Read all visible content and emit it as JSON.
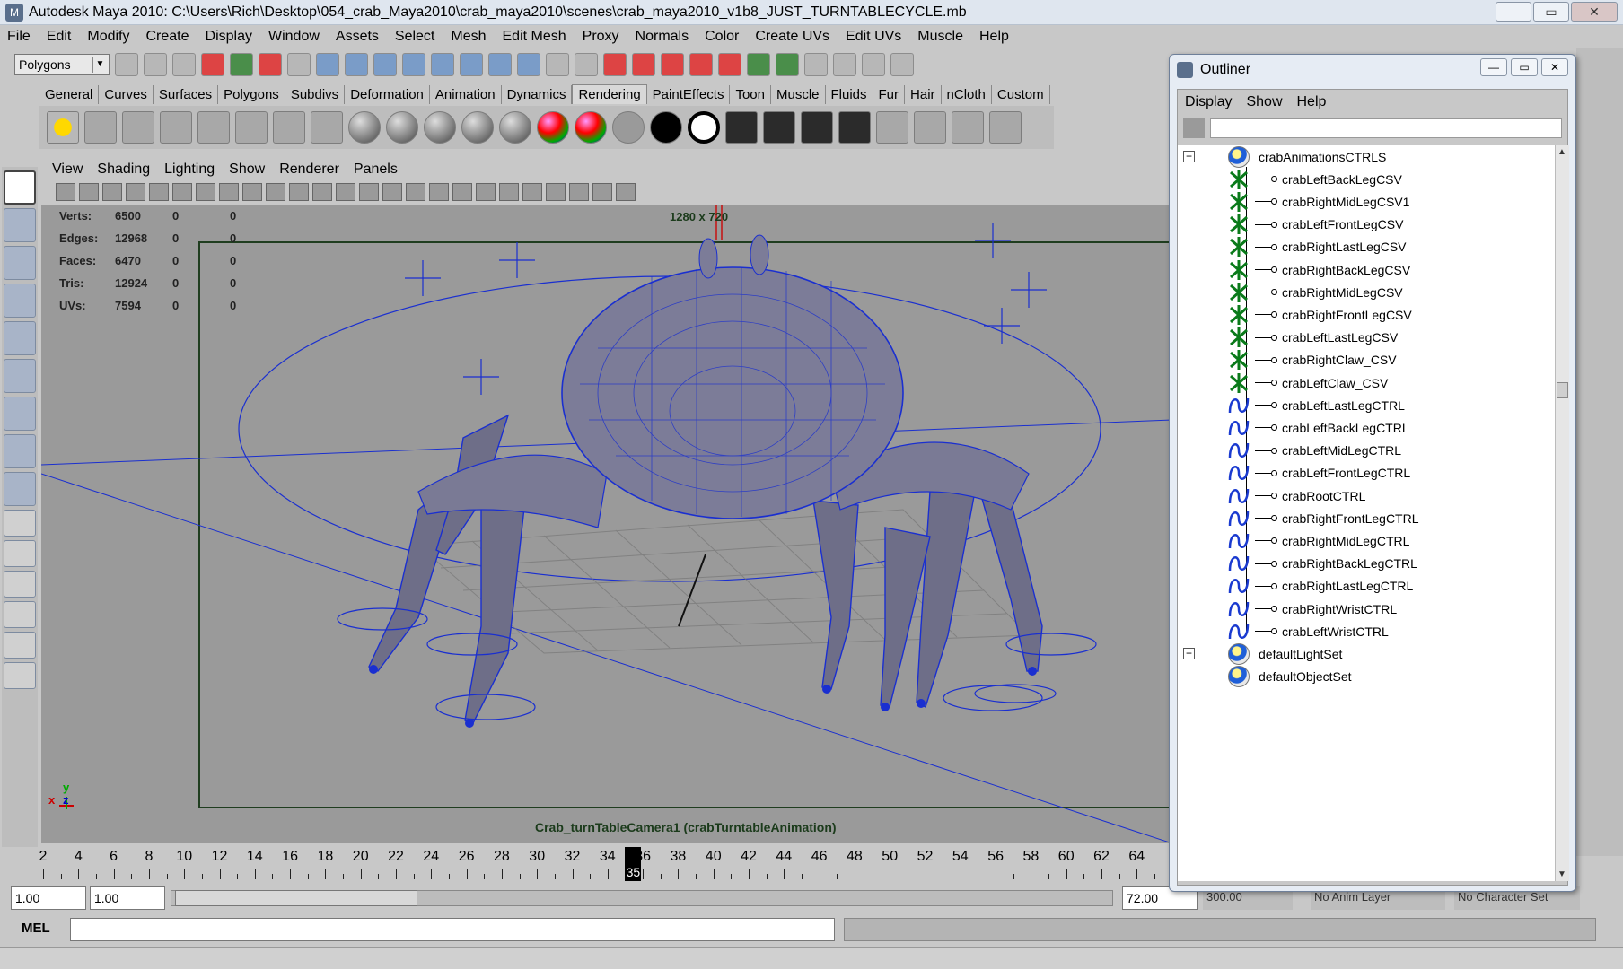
{
  "window": {
    "title": "Autodesk Maya 2010: C:\\Users\\Rich\\Desktop\\054_crab_Maya2010\\crab_maya2010\\scenes\\crab_maya2010_v1b8_JUST_TURNTABLECYCLE.mb"
  },
  "menubar": [
    "File",
    "Edit",
    "Modify",
    "Create",
    "Display",
    "Window",
    "Assets",
    "Select",
    "Mesh",
    "Edit Mesh",
    "Proxy",
    "Normals",
    "Color",
    "Create UVs",
    "Edit UVs",
    "Muscle",
    "Help"
  ],
  "status_line": {
    "mode": "Polygons"
  },
  "shelf_tabs": [
    "General",
    "Curves",
    "Surfaces",
    "Polygons",
    "Subdivs",
    "Deformation",
    "Animation",
    "Dynamics",
    "Rendering",
    "PaintEffects",
    "Toon",
    "Muscle",
    "Fluids",
    "Fur",
    "Hair",
    "nCloth",
    "Custom"
  ],
  "shelf_active_tab": "Rendering",
  "panel_menu": [
    "View",
    "Shading",
    "Lighting",
    "Show",
    "Renderer",
    "Panels"
  ],
  "hud": {
    "rows": [
      {
        "label": "Verts:",
        "v1": "6500",
        "v2": "0",
        "v3": "0"
      },
      {
        "label": "Edges:",
        "v1": "12968",
        "v2": "0",
        "v3": "0"
      },
      {
        "label": "Faces:",
        "v1": "6470",
        "v2": "0",
        "v3": "0"
      },
      {
        "label": "Tris:",
        "v1": "12924",
        "v2": "0",
        "v3": "0"
      },
      {
        "label": "UVs:",
        "v1": "7594",
        "v2": "0",
        "v3": "0"
      }
    ]
  },
  "viewport": {
    "resolution_gate": "1280 x 720",
    "camera_label": "Crab_turnTableCamera1 (crabTurntableAnimation)",
    "axis_x": "x",
    "axis_y": "y",
    "axis_z": "z"
  },
  "timeline": {
    "labels": [
      "2",
      "4",
      "6",
      "8",
      "10",
      "12",
      "14",
      "16",
      "18",
      "20",
      "22",
      "24",
      "26",
      "28",
      "30",
      "32",
      "34",
      "36",
      "38",
      "40",
      "42",
      "44",
      "46",
      "48",
      "50",
      "52",
      "54",
      "56",
      "58",
      "60",
      "62",
      "64"
    ],
    "current_frame": "35"
  },
  "range": {
    "start": "1.00",
    "playback_start": "1.00",
    "playback_end": "72.00",
    "end": "300.00",
    "anim_layer": "No Anim Layer",
    "character_set": "No Character Set"
  },
  "command_line": {
    "label": "MEL",
    "value": ""
  },
  "outliner": {
    "title": "Outliner",
    "menu": [
      "Display",
      "Show",
      "Help"
    ],
    "filter": "",
    "root": "crabAnimationsCTRLS",
    "children": [
      {
        "name": "crabLeftBackLegCSV",
        "icon": "cluster-icon"
      },
      {
        "name": "crabRightMidLegCSV1",
        "icon": "cluster-icon"
      },
      {
        "name": "crabLeftFrontLegCSV",
        "icon": "cluster-icon"
      },
      {
        "name": "crabRightLastLegCSV",
        "icon": "cluster-icon"
      },
      {
        "name": "crabRightBackLegCSV",
        "icon": "cluster-icon"
      },
      {
        "name": "crabRightMidLegCSV",
        "icon": "cluster-icon"
      },
      {
        "name": "crabRightFrontLegCSV",
        "icon": "cluster-icon"
      },
      {
        "name": "crabLeftLastLegCSV",
        "icon": "cluster-icon"
      },
      {
        "name": "crabRightClaw_CSV",
        "icon": "cluster-icon"
      },
      {
        "name": "crabLeftClaw_CSV",
        "icon": "cluster-icon"
      },
      {
        "name": "crabLeftLastLegCTRL",
        "icon": "curve-icon"
      },
      {
        "name": "crabLeftBackLegCTRL",
        "icon": "curve-icon"
      },
      {
        "name": "crabLeftMidLegCTRL",
        "icon": "curve-icon"
      },
      {
        "name": "crabLeftFrontLegCTRL",
        "icon": "curve-icon"
      },
      {
        "name": "crabRootCTRL",
        "icon": "curve-icon"
      },
      {
        "name": "crabRightFrontLegCTRL",
        "icon": "curve-icon"
      },
      {
        "name": "crabRightMidLegCTRL",
        "icon": "curve-icon"
      },
      {
        "name": "crabRightBackLegCTRL",
        "icon": "curve-icon"
      },
      {
        "name": "crabRightLastLegCTRL",
        "icon": "curve-icon"
      },
      {
        "name": "crabRightWristCTRL",
        "icon": "curve-icon"
      },
      {
        "name": "crabLeftWristCTRL",
        "icon": "curve-icon"
      }
    ],
    "sets": [
      "defaultLightSet",
      "defaultObjectSet"
    ]
  }
}
